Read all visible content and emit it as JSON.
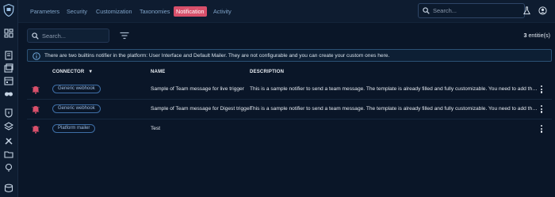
{
  "topbar": {
    "tabs": [
      {
        "label": "Parameters",
        "active": false
      },
      {
        "label": "Security",
        "active": false
      },
      {
        "label": "Customization",
        "active": false
      },
      {
        "label": "Taxonomies",
        "active": false
      },
      {
        "label": "Notification",
        "active": true
      },
      {
        "label": "Activity",
        "active": false
      }
    ],
    "search_placeholder": "Search...",
    "icons": [
      "flask-icon",
      "user-account-icon"
    ],
    "accent_color": "#d8506b"
  },
  "sidebar": {
    "logo": "opencti-shield-logo",
    "icons": [
      "dashboard-icon",
      "analyses-icon",
      "cases-icon",
      "events-icon",
      "observations-icon",
      "threats-icon",
      "arsenal-icon",
      "techniques-icon",
      "entities-icon",
      "locations-icon",
      "data-icon",
      "settings-icon"
    ]
  },
  "toolbar": {
    "search_placeholder": "Search...",
    "filter_icon": "filter-list-icon",
    "entity_count": "3",
    "entity_suffix": "entitie(s)"
  },
  "banner": {
    "text": "There are two builtins notifier in the platform: User Interface and Default Mailer. They are not configurable and you can create your custom ones here."
  },
  "table": {
    "headers": {
      "connector": "CONNECTOR",
      "name": "NAME",
      "description": "DESCRIPTION"
    },
    "rows": [
      {
        "connector": "Generic webhook",
        "name": "Sample of Team message for live trigger",
        "description": "This is a sample notifier to send a team message. The template is already filled and fully customizable. You need to add the correct Microsoft Teams endpoint to get it working."
      },
      {
        "connector": "Generic webhook",
        "name": "Sample of Team message for Digest trigger",
        "description": "This is a sample notifier to send a team message. The template is already filled and fully customizable. You need to add the correct Microsoft Teams endpoint to get it working."
      },
      {
        "connector": "Platform mailer",
        "name": "Test",
        "description": ""
      }
    ]
  }
}
